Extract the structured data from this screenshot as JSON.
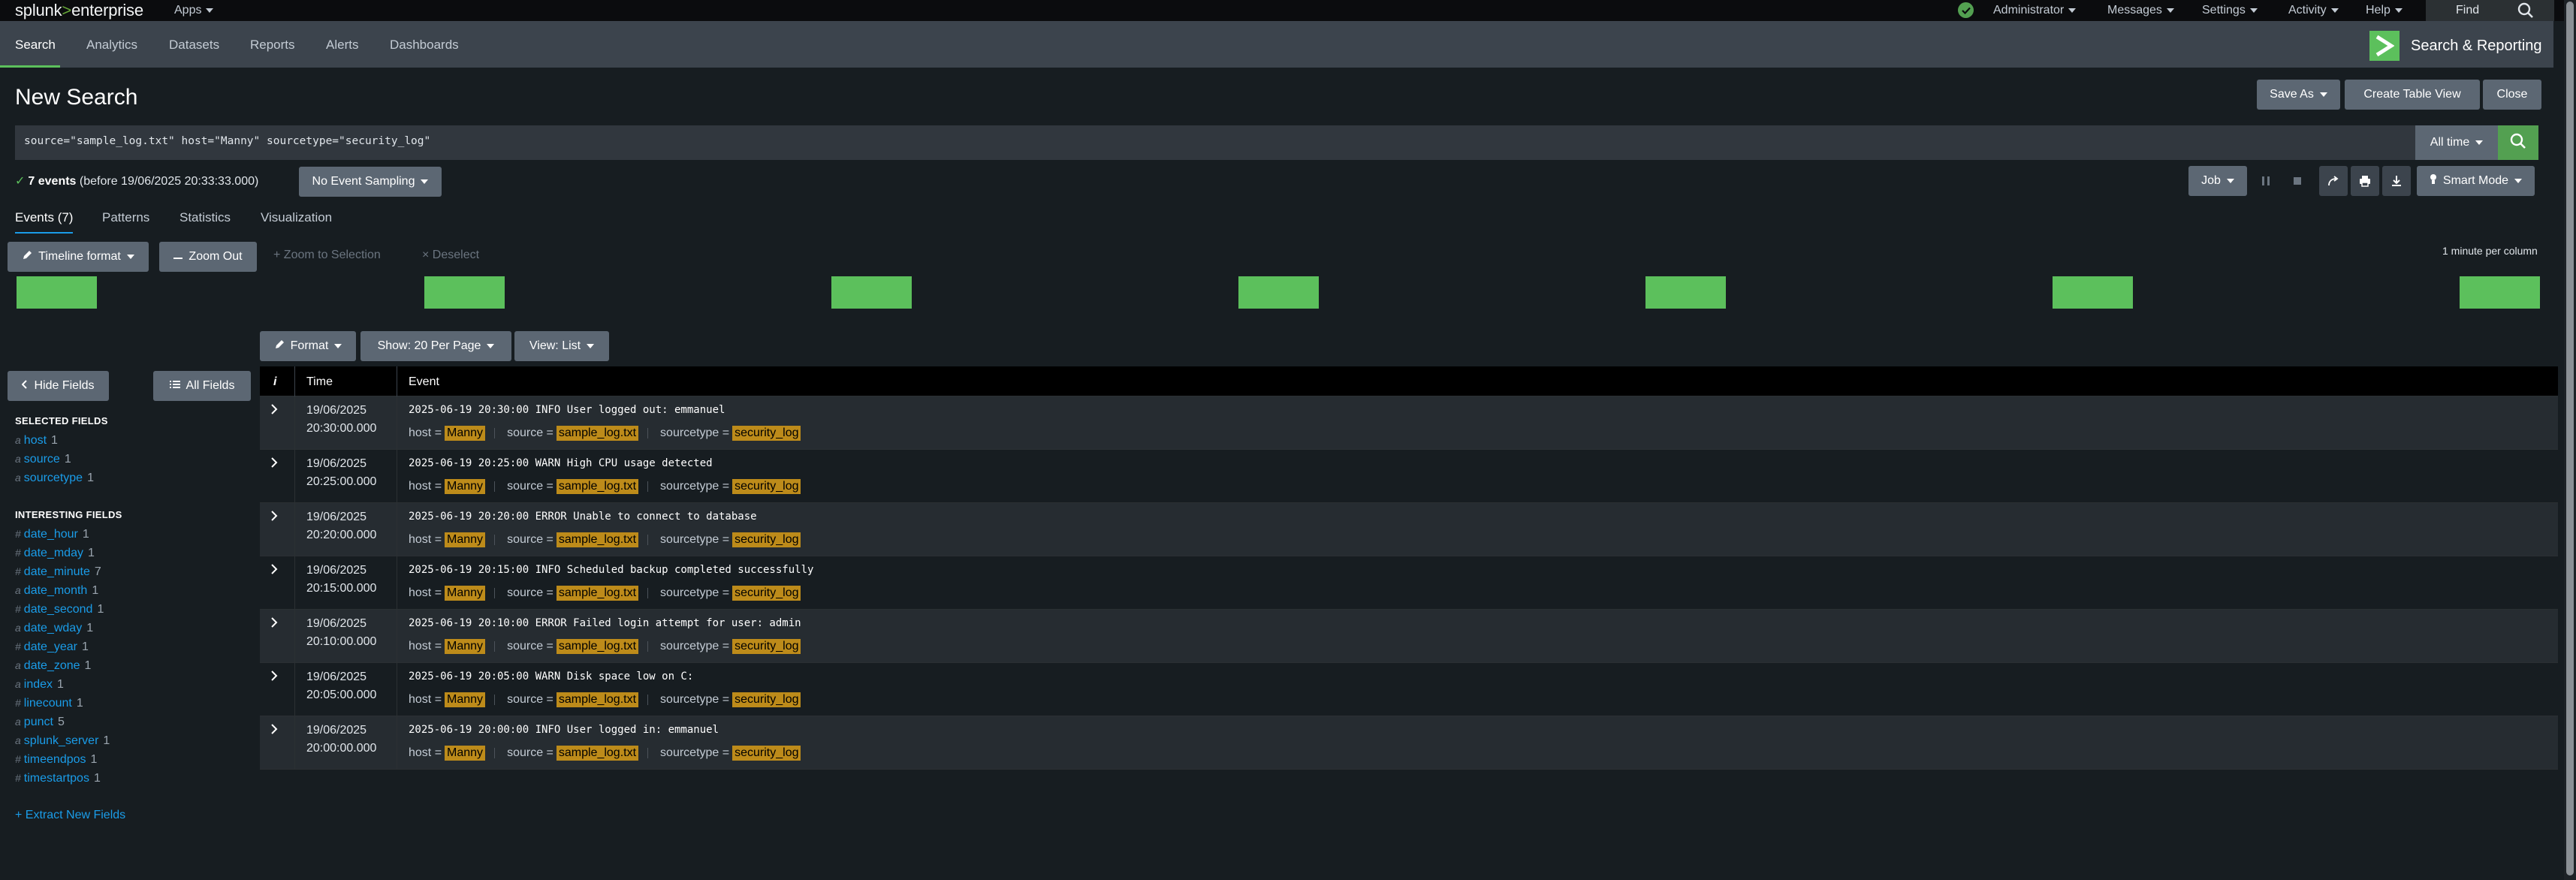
{
  "topbar": {
    "logo_main": "splunk",
    "logo_gt": ">",
    "logo_sub": "enterprise",
    "menus": {
      "apps": "Apps",
      "administrator": "Administrator",
      "messages": "Messages",
      "settings": "Settings",
      "activity": "Activity",
      "help": "Help"
    },
    "find_label": "Find",
    "status_icon": "check-circle-icon"
  },
  "app_nav": {
    "tabs": [
      "Search",
      "Analytics",
      "Datasets",
      "Reports",
      "Alerts",
      "Dashboards"
    ],
    "active": "Search",
    "app_name": "Search & Reporting"
  },
  "page": {
    "title": "New Search",
    "save_as": "Save As",
    "create_table_view": "Create Table View",
    "close": "Close"
  },
  "search": {
    "query": "source=\"sample_log.txt\" host=\"Manny\" sourcetype=\"security_log\"",
    "time_range": "All time"
  },
  "status": {
    "check": "✓",
    "count": "7 events",
    "detail": "(before 19/06/2025 20:33:33.000)",
    "sampling": "No Event Sampling",
    "job": "Job",
    "mode": "Smart Mode"
  },
  "result_tabs": [
    "Events (7)",
    "Patterns",
    "Statistics",
    "Visualization"
  ],
  "timeline": {
    "format": "Timeline format",
    "zoom_out": "Zoom Out",
    "zoom_selection": "Zoom to Selection",
    "deselect": "Deselect",
    "per_column": "1 minute per column",
    "bar_counts": [
      1,
      1,
      1,
      1,
      1,
      1,
      1
    ]
  },
  "list_controls": {
    "format": "Format",
    "per_page": "Show: 20 Per Page",
    "view": "View: List"
  },
  "sidebar": {
    "hide_fields": "Hide Fields",
    "all_fields": "All Fields",
    "selected_heading": "SELECTED FIELDS",
    "selected": [
      {
        "type": "a",
        "name": "host",
        "count": "1"
      },
      {
        "type": "a",
        "name": "source",
        "count": "1"
      },
      {
        "type": "a",
        "name": "sourcetype",
        "count": "1"
      }
    ],
    "interesting_heading": "INTERESTING FIELDS",
    "interesting": [
      {
        "type": "#",
        "name": "date_hour",
        "count": "1"
      },
      {
        "type": "#",
        "name": "date_mday",
        "count": "1"
      },
      {
        "type": "#",
        "name": "date_minute",
        "count": "7"
      },
      {
        "type": "a",
        "name": "date_month",
        "count": "1"
      },
      {
        "type": "#",
        "name": "date_second",
        "count": "1"
      },
      {
        "type": "a",
        "name": "date_wday",
        "count": "1"
      },
      {
        "type": "#",
        "name": "date_year",
        "count": "1"
      },
      {
        "type": "a",
        "name": "date_zone",
        "count": "1"
      },
      {
        "type": "a",
        "name": "index",
        "count": "1"
      },
      {
        "type": "#",
        "name": "linecount",
        "count": "1"
      },
      {
        "type": "a",
        "name": "punct",
        "count": "5"
      },
      {
        "type": "a",
        "name": "splunk_server",
        "count": "1"
      },
      {
        "type": "#",
        "name": "timeendpos",
        "count": "1"
      },
      {
        "type": "#",
        "name": "timestartpos",
        "count": "1"
      }
    ],
    "extract": "+ Extract New Fields"
  },
  "table": {
    "headers": {
      "info": "i",
      "time": "Time",
      "event": "Event"
    },
    "meta_labels": {
      "host": "host =",
      "source": "source =",
      "sourcetype": "sourcetype ="
    },
    "events": [
      {
        "date": "19/06/2025",
        "time": "20:30:00.000",
        "raw": "2025-06-19 20:30:00 INFO User logged out: emmanuel",
        "host": "Manny",
        "source": "sample_log.txt",
        "sourcetype": "security_log"
      },
      {
        "date": "19/06/2025",
        "time": "20:25:00.000",
        "raw": "2025-06-19 20:25:00 WARN High CPU usage detected",
        "host": "Manny",
        "source": "sample_log.txt",
        "sourcetype": "security_log"
      },
      {
        "date": "19/06/2025",
        "time": "20:20:00.000",
        "raw": "2025-06-19 20:20:00 ERROR Unable to connect to database",
        "host": "Manny",
        "source": "sample_log.txt",
        "sourcetype": "security_log"
      },
      {
        "date": "19/06/2025",
        "time": "20:15:00.000",
        "raw": "2025-06-19 20:15:00 INFO Scheduled backup completed successfully",
        "host": "Manny",
        "source": "sample_log.txt",
        "sourcetype": "security_log"
      },
      {
        "date": "19/06/2025",
        "time": "20:10:00.000",
        "raw": "2025-06-19 20:10:00 ERROR Failed login attempt for user: admin",
        "host": "Manny",
        "source": "sample_log.txt",
        "sourcetype": "security_log"
      },
      {
        "date": "19/06/2025",
        "time": "20:05:00.000",
        "raw": "2025-06-19 20:05:00 WARN Disk space low on C:",
        "host": "Manny",
        "source": "sample_log.txt",
        "sourcetype": "security_log"
      },
      {
        "date": "19/06/2025",
        "time": "20:00:00.000",
        "raw": "2025-06-19 20:00:00 INFO User logged in: emmanuel",
        "host": "Manny",
        "source": "sample_log.txt",
        "sourcetype": "security_log"
      }
    ]
  },
  "colors": {
    "accent_green": "#5cc05c",
    "link_blue": "#1a9ce8",
    "highlight": "#bd8b1a"
  }
}
